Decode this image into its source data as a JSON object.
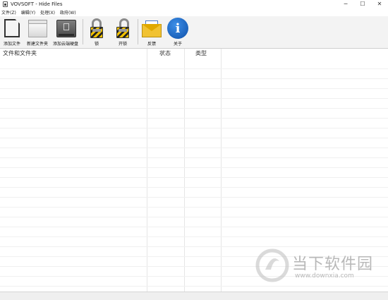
{
  "window": {
    "title": "VOVSOFT - Hide Files",
    "controls": [
      "─",
      "☐",
      "✕"
    ]
  },
  "menu": [
    "文件(Z)",
    "编辑(Y)",
    "处理(X)",
    "政府(W)"
  ],
  "toolbar": {
    "add_file": "添加文件",
    "new_folder": "新建文件夹",
    "add_drive": "添加云端硬盘",
    "lock": "锁",
    "unlock": "开锁",
    "feedback": "反馈",
    "about": "关于"
  },
  "columns": {
    "files": "文件和文件夹",
    "status": "状态",
    "type": "类型"
  },
  "watermark": {
    "name": "当下软件园",
    "url": "www.downxia.com"
  }
}
